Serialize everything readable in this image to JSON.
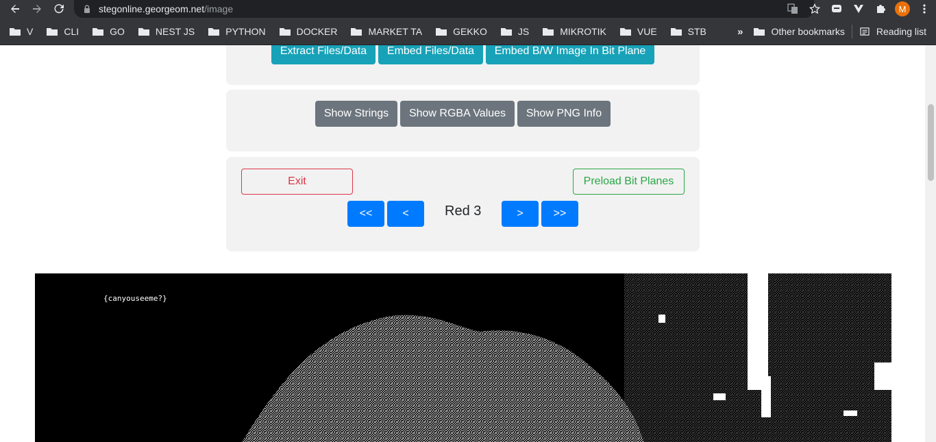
{
  "browser": {
    "url_host": "stegonline.georgeom.net",
    "url_path": "/image",
    "avatar_letter": "M",
    "bookmarks": [
      "V",
      "CLI",
      "GO",
      "NEST JS",
      "PYTHON",
      "DOCKER",
      "MARKET TA",
      "GEKKO",
      "JS",
      "MIKROTIK",
      "VUE",
      "STB"
    ],
    "other_bookmarks": "Other bookmarks",
    "reading_list": "Reading list",
    "overflow": "»"
  },
  "extract_card": {
    "extract": "Extract Files/Data",
    "embed": "Embed Files/Data",
    "embed_bw": "Embed B/W Image In Bit Plane"
  },
  "info_card": {
    "show_strings": "Show Strings",
    "show_rgba": "Show RGBA Values",
    "show_png": "Show PNG Info"
  },
  "bitplane_card": {
    "exit": "Exit",
    "preload": "Preload Bit Planes",
    "first": "<<",
    "prev": "<",
    "current_plane": "Red 3",
    "next": ">",
    "last": ">>"
  },
  "bitplane_image": {
    "visible_text": "{canyouseeme?}"
  },
  "colors": {
    "info": "#17a2b8",
    "secondary": "#6c757d",
    "primary": "#007bff",
    "danger": "#dc3545",
    "success": "#28a745"
  }
}
